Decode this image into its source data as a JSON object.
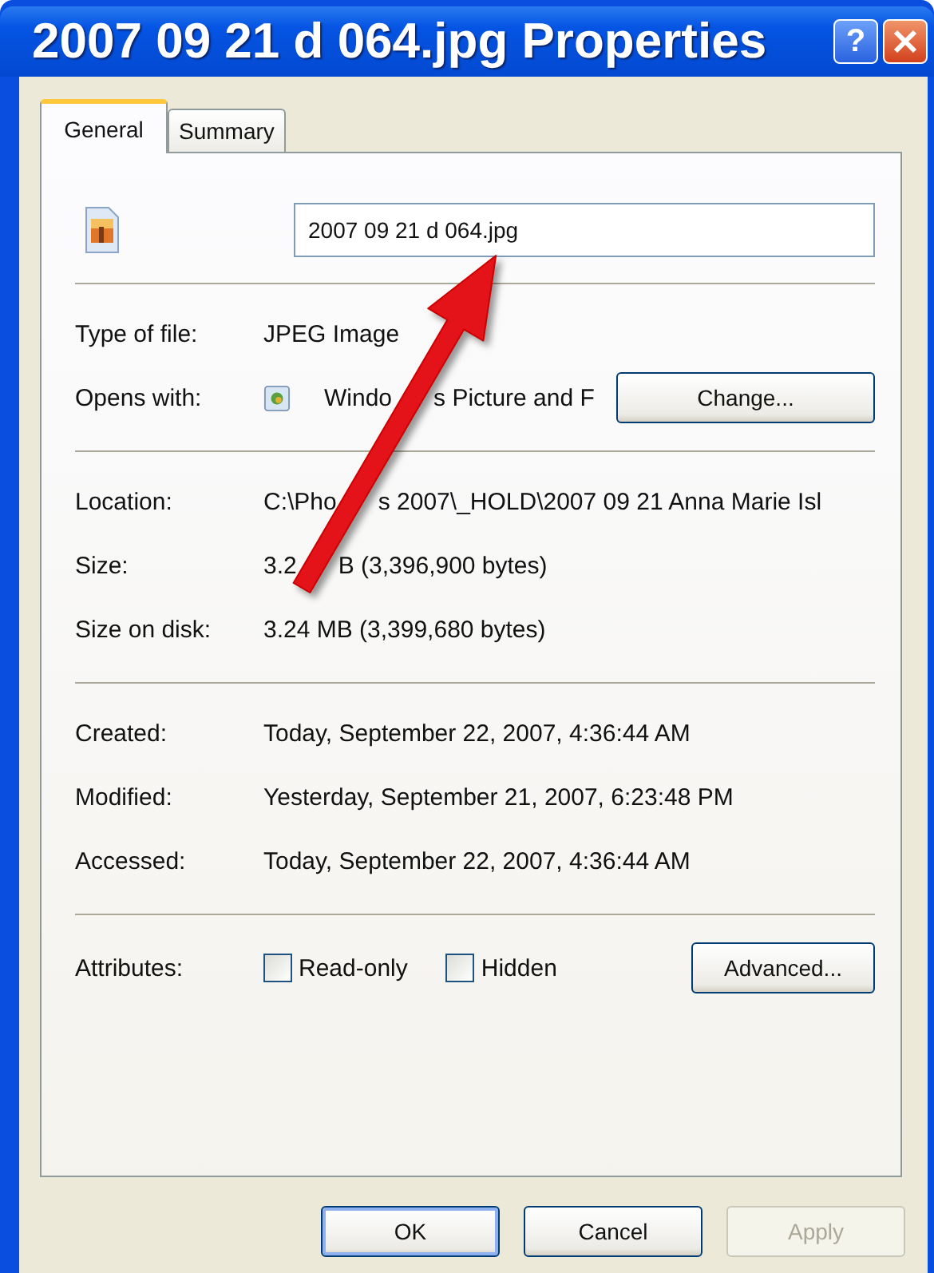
{
  "window": {
    "title": "2007 09 21 d 064.jpg Properties",
    "help": "?"
  },
  "tabs": [
    {
      "label": "General",
      "selected": true
    },
    {
      "label": "Summary",
      "selected": false
    }
  ],
  "file_name": {
    "value": "2007 09 21 d 064.jpg"
  },
  "sections": [
    [
      {
        "label": "Type of file:",
        "value": [
          "JPEG Image"
        ]
      },
      {
        "label": "Opens with:",
        "value": [
          "Windo",
          "s Picture and F"
        ],
        "button": "Change..."
      }
    ],
    [
      {
        "label": "Location:",
        "value": [
          "C:\\Pho",
          "s 2007\\_HOLD\\2007 09 21 Anna Marie Isl"
        ]
      },
      {
        "label": "Size:",
        "value": [
          "3.2",
          "B (3,396,900 bytes)"
        ]
      },
      {
        "label": "Size on disk:",
        "value": [
          "3.24 MB (3,399,680 bytes)"
        ]
      }
    ],
    [
      {
        "label": "Created:",
        "value": [
          "Today, September 22, 2007, 4:36:44 AM"
        ]
      },
      {
        "label": "Modified:",
        "value": [
          "Yesterday, September 21, 2007, 6:23:48 PM"
        ]
      },
      {
        "label": "Accessed:",
        "value": [
          "Today, September 22, 2007, 4:36:44 AM"
        ]
      }
    ]
  ],
  "attributes": {
    "label": "Attributes:",
    "checkboxes": [
      {
        "label": "Read-only",
        "checked": false
      },
      {
        "label": "Hidden",
        "checked": false
      }
    ],
    "button": "Advanced..."
  },
  "buttons": [
    {
      "label": "OK",
      "disabled": false,
      "default": true
    },
    {
      "label": "Cancel",
      "disabled": false,
      "default": false
    },
    {
      "label": "Apply",
      "disabled": true,
      "default": false
    }
  ]
}
